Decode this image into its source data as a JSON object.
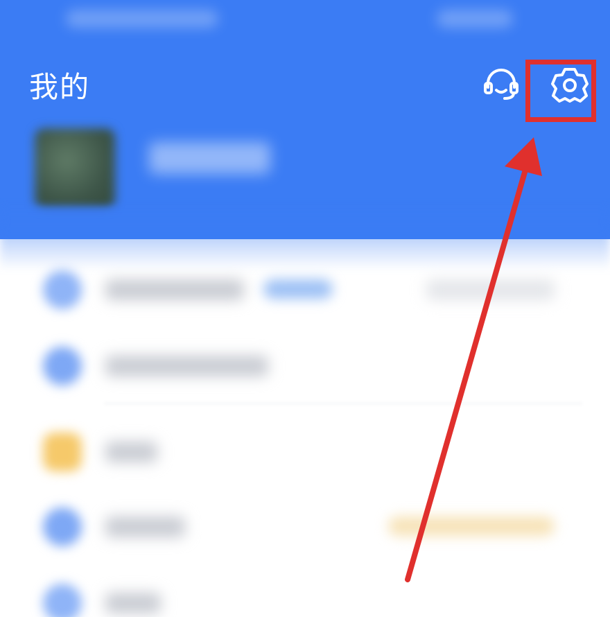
{
  "header": {
    "title": "我的",
    "customer_service_icon": "headset-icon",
    "settings_icon": "gear-icon",
    "background_color": "#3b7cf4"
  },
  "profile": {
    "avatar": "blurred-avatar",
    "username": ""
  },
  "menu": {
    "items": [
      {
        "icon_color": "#8fb4f7",
        "label": "",
        "badge_color": "#9cc0f5",
        "right_text": ""
      },
      {
        "icon_color": "#7ea8f5",
        "label": "",
        "right_text": ""
      },
      {
        "icon_color": "#f6c96a",
        "label": "",
        "right_text": ""
      },
      {
        "icon_color": "#7ea8f5",
        "label": "",
        "badge_color": "#f7e3b8",
        "right_text": ""
      },
      {
        "icon_color": "#8fb4f7",
        "label": "",
        "right_text": ""
      }
    ]
  },
  "annotation": {
    "highlight_color": "#e0302d",
    "target": "settings-button"
  }
}
